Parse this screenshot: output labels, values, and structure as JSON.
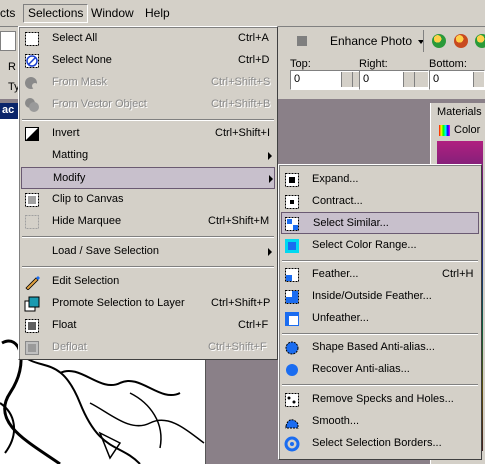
{
  "menubar": {
    "items": [
      "cts",
      "Selections",
      "Window",
      "Help"
    ]
  },
  "toolbar": {
    "enhance_label": "Enhance Photo",
    "left_fields": [
      "R",
      "Ty"
    ]
  },
  "options": {
    "top_label": "Top:",
    "right_label": "Right:",
    "bottom_label": "Bottom:",
    "top_value": "0",
    "right_value": "0",
    "bottom_value": "0"
  },
  "panels": {
    "materials_title": "Materials",
    "materials_tab": "Color"
  },
  "workspace": {
    "doc_tab": "ac"
  },
  "selections_menu": {
    "items": [
      {
        "label": "Select All",
        "shortcut": "Ctrl+A",
        "disabled": false,
        "icon": "select-all-icon"
      },
      {
        "label": "Select None",
        "shortcut": "Ctrl+D",
        "disabled": false,
        "icon": "select-none-icon"
      },
      {
        "label": "From Mask",
        "shortcut": "Ctrl+Shift+S",
        "disabled": true,
        "icon": "from-mask-icon"
      },
      {
        "label": "From Vector Object",
        "shortcut": "Ctrl+Shift+B",
        "disabled": true,
        "icon": "from-vector-icon"
      },
      {
        "label": "Invert",
        "shortcut": "Ctrl+Shift+I",
        "disabled": false,
        "icon": "invert-icon"
      },
      {
        "label": "Matting",
        "shortcut": "",
        "disabled": false,
        "submenu": true
      },
      {
        "label": "Modify",
        "shortcut": "",
        "disabled": false,
        "submenu": true,
        "highlighted": true
      },
      {
        "label": "Clip to Canvas",
        "shortcut": "",
        "disabled": false,
        "icon": "clip-canvas-icon"
      },
      {
        "label": "Hide Marquee",
        "shortcut": "Ctrl+Shift+M",
        "disabled": false,
        "icon": "hide-marquee-icon"
      },
      {
        "label": "Load / Save Selection",
        "shortcut": "",
        "disabled": false,
        "submenu": true
      },
      {
        "label": "Edit Selection",
        "shortcut": "",
        "disabled": false,
        "icon": "edit-selection-icon"
      },
      {
        "label": "Promote Selection to Layer",
        "shortcut": "Ctrl+Shift+P",
        "disabled": false,
        "icon": "promote-layer-icon"
      },
      {
        "label": "Float",
        "shortcut": "Ctrl+F",
        "disabled": false,
        "icon": "float-icon"
      },
      {
        "label": "Defloat",
        "shortcut": "Ctrl+Shift+F",
        "disabled": true,
        "icon": "defloat-icon"
      }
    ]
  },
  "modify_submenu": {
    "items": [
      {
        "label": "Expand...",
        "shortcut": ""
      },
      {
        "label": "Contract...",
        "shortcut": ""
      },
      {
        "label": "Select Similar...",
        "shortcut": "",
        "highlighted": true
      },
      {
        "label": "Select Color Range...",
        "shortcut": ""
      },
      {
        "label": "Feather...",
        "shortcut": "Ctrl+H"
      },
      {
        "label": "Inside/Outside Feather...",
        "shortcut": ""
      },
      {
        "label": "Unfeather...",
        "shortcut": ""
      },
      {
        "label": "Shape Based Anti-alias...",
        "shortcut": ""
      },
      {
        "label": "Recover Anti-alias...",
        "shortcut": ""
      },
      {
        "label": "Remove Specks and Holes...",
        "shortcut": ""
      },
      {
        "label": "Smooth...",
        "shortcut": ""
      },
      {
        "label": "Select Selection Borders...",
        "shortcut": ""
      }
    ]
  },
  "colors": {
    "menu_bg": "#d4d0c8",
    "highlight_bg": "#c8c0cc",
    "highlight_border": "#6a5a72",
    "workspace_bg": "#8a8088",
    "icon_blue": "#1a6cf0",
    "icon_cyan": "#00d8f0"
  }
}
